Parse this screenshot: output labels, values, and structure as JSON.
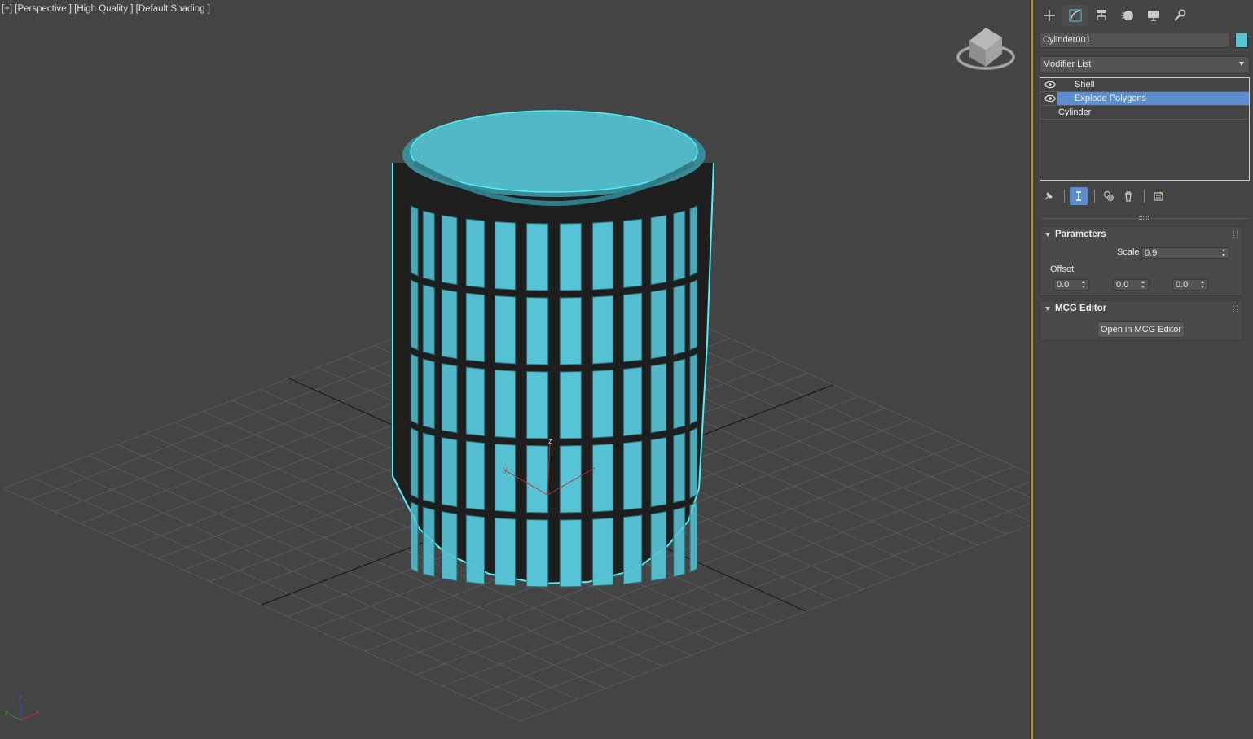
{
  "viewport": {
    "label": "[+] [Perspective ] [High Quality ] [Default Shading ]",
    "axis_labels": {
      "x": "x",
      "y": "y",
      "z": "z"
    }
  },
  "command_panel": {
    "tabs": [
      {
        "name": "create",
        "icon": "plus-icon"
      },
      {
        "name": "modify",
        "icon": "modify-curve-icon",
        "active": true
      },
      {
        "name": "hierarchy",
        "icon": "hierarchy-icon"
      },
      {
        "name": "motion",
        "icon": "motion-icon"
      },
      {
        "name": "display",
        "icon": "display-monitor-icon"
      },
      {
        "name": "utilities",
        "icon": "wrench-icon"
      }
    ],
    "object_name": "Cylinder001",
    "object_color": "#56c4d6",
    "modifier_list_label": "Modifier List",
    "stack": [
      {
        "label": "Shell",
        "visible": true,
        "selected": false
      },
      {
        "label": "Explode Polygons",
        "visible": true,
        "selected": true
      },
      {
        "label": "Cylinder",
        "visible": false,
        "selected": false
      }
    ],
    "parameters": {
      "title": "Parameters",
      "scale_label": "Scale",
      "scale_value": "0.9",
      "offset_label": "Offset",
      "offset_values": [
        "0.0",
        "0.0",
        "0.0"
      ]
    },
    "mcg_editor": {
      "title": "MCG Editor",
      "button_label": "Open in MCG Editor"
    }
  },
  "colors": {
    "background": "#444444",
    "object": "#56c4d6",
    "selection_highlight": "#5a8ecf",
    "divider": "#b08b3a"
  }
}
